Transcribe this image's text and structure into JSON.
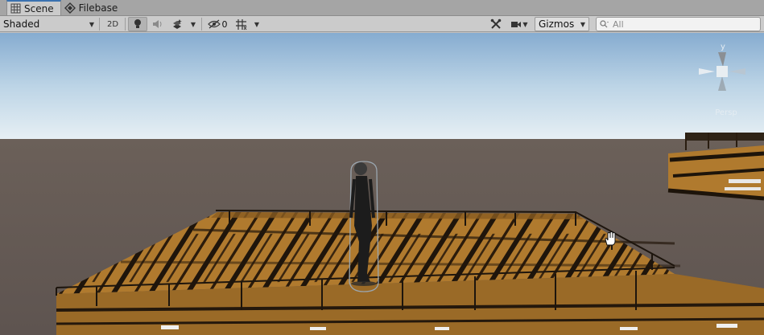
{
  "tabs": [
    {
      "label": "Scene",
      "icon": "grid-icon",
      "active": true
    },
    {
      "label": "Filebase",
      "icon": "filebase-icon",
      "active": false
    }
  ],
  "toolbar": {
    "shading_mode": "Shaded",
    "mode_2d_label": "2D",
    "hidden_count": "0",
    "gizmos_label": "Gizmos",
    "search_placeholder": "All"
  },
  "scene_gizmo": {
    "y_axis_label": "y",
    "projection_label": "Persp"
  },
  "colors": {
    "toolbar_bg": "#cbcbcb",
    "tab_bar_bg": "#a5a5a5",
    "sky_top": "#8fb4d6",
    "horizon": "#e0ecf3",
    "ground": "#6a5f58",
    "wood": "#b07a2e",
    "accent": "#3a72b0"
  }
}
